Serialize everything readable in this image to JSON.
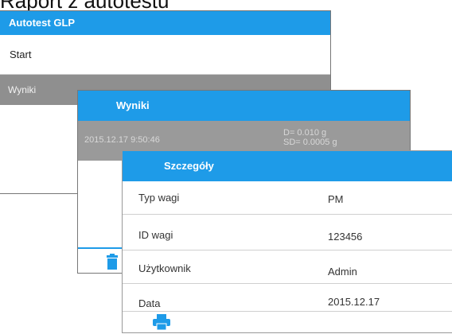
{
  "caption": "Raport z autotestu",
  "glp_window": {
    "title": "Autotest GLP",
    "items": [
      "Start",
      "Wyniki"
    ]
  },
  "results_window": {
    "title": "Wyniki",
    "entry": {
      "datetime": "2015.12.17  9:50:46",
      "value_line1": "D= 0.010 g",
      "value_line2": "SD= 0.0005 g"
    },
    "trash_icon": "trash-icon"
  },
  "details_window": {
    "title": "Szczegóły",
    "rows": [
      {
        "label": "Typ wagi",
        "value": "PM"
      },
      {
        "label": "ID wagi",
        "value": "123456"
      },
      {
        "label": "Użytkownik",
        "value": "Admin"
      },
      {
        "label": "Data",
        "value": "2015.12.17"
      }
    ],
    "print_icon": "printer-icon"
  },
  "colors": {
    "accent": "#1e9be8",
    "selected_row": "#8f8f8f"
  }
}
